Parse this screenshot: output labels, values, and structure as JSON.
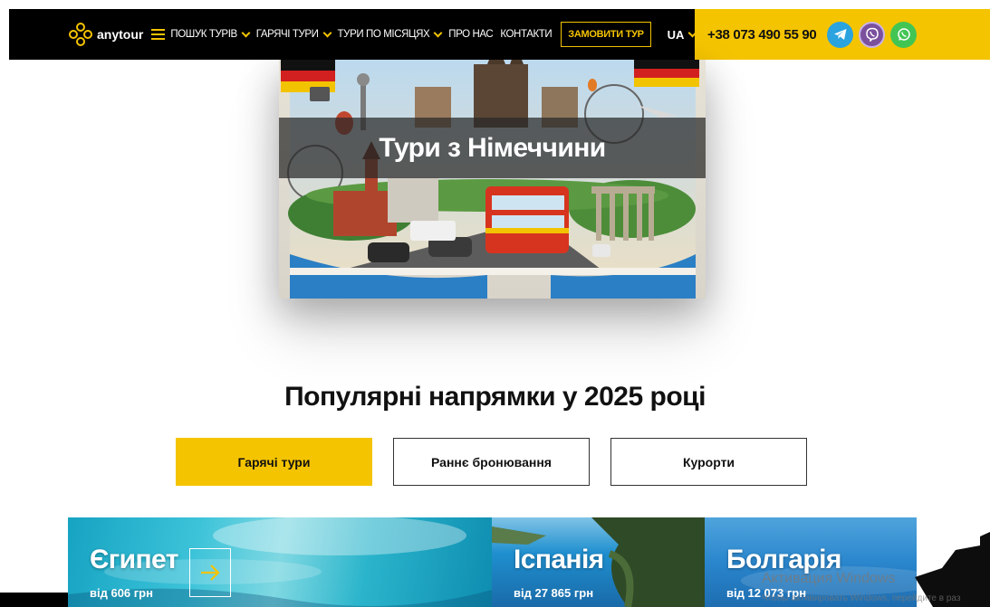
{
  "header": {
    "logo_text": "anytour",
    "nav": [
      {
        "label": "ПОШУК ТУРІВ",
        "has_dropdown": true
      },
      {
        "label": "ГАРЯЧІ ТУРИ",
        "has_dropdown": true
      },
      {
        "label": "ТУРИ ПО МІСЯЦЯХ",
        "has_dropdown": true
      },
      {
        "label": "ПРО НАС",
        "has_dropdown": false
      },
      {
        "label": "КОНТАКТИ",
        "has_dropdown": false
      }
    ],
    "order_button": "ЗАМОВИТИ ТУР",
    "language": "UA",
    "phone": "+38 073 490 55 90",
    "messengers": [
      "telegram-icon",
      "viber-icon",
      "whatsapp-icon"
    ],
    "colors": {
      "accent": "#f5c400",
      "bar": "#000000"
    }
  },
  "hero": {
    "title": "Тури з Німеччини"
  },
  "section": {
    "title": "Популярні напрямки у 2025 році",
    "tabs": [
      {
        "label": "Гарячі тури",
        "active": true
      },
      {
        "label": "Раннє бронювання",
        "active": false
      },
      {
        "label": "Курорти",
        "active": false
      }
    ]
  },
  "cards": [
    {
      "name": "Єгипет",
      "price": "від 606 грн"
    },
    {
      "name": "Іспанія",
      "price": "від 27 865 грн"
    },
    {
      "name": "Болгарія",
      "price": "від 12 073 грн"
    }
  ],
  "watermark": {
    "title": "Активация Windows",
    "subtitle": "Чтобы активировать Windows, перейдите в раз"
  }
}
